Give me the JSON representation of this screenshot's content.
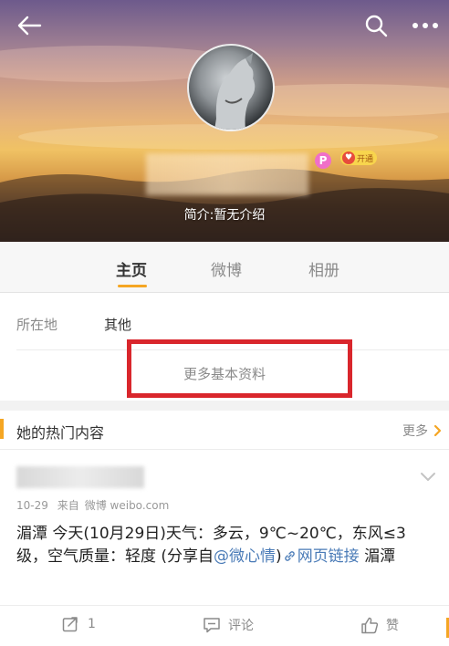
{
  "header": {
    "bio": "简介:暂无介绍",
    "vip_label": "开通",
    "membership_letter": "P"
  },
  "tabs": [
    {
      "label": "主页",
      "active": true
    },
    {
      "label": "微博",
      "active": false
    },
    {
      "label": "相册",
      "active": false
    }
  ],
  "info": {
    "location_key": "所在地",
    "location_value": "其他",
    "more_info": "更多基本资料"
  },
  "hot": {
    "title": "她的热门内容",
    "more": "更多"
  },
  "post": {
    "date": "10-29",
    "source_prefix": "来自",
    "source": "微博 weibo.com",
    "text_main": "湄潭 今天(10月29日)天气：多云，9℃~20℃，东风≤3级，空气质量：轻度 (分享自",
    "mention": "@微心情",
    "close_paren": ")",
    "link_label": "网页链接",
    "text_tail": " 湄潭"
  },
  "actions": {
    "repost_count": "1",
    "comment_label": "评论",
    "like_label": "赞"
  },
  "colors": {
    "accent": "#f5a623",
    "highlight_box": "#d9262c",
    "link": "#4a7bb7"
  },
  "icons": [
    "back-arrow-icon",
    "search-icon",
    "more-icon",
    "chevron-right-icon",
    "chevron-down-icon",
    "repost-icon",
    "comment-icon",
    "like-icon"
  ]
}
